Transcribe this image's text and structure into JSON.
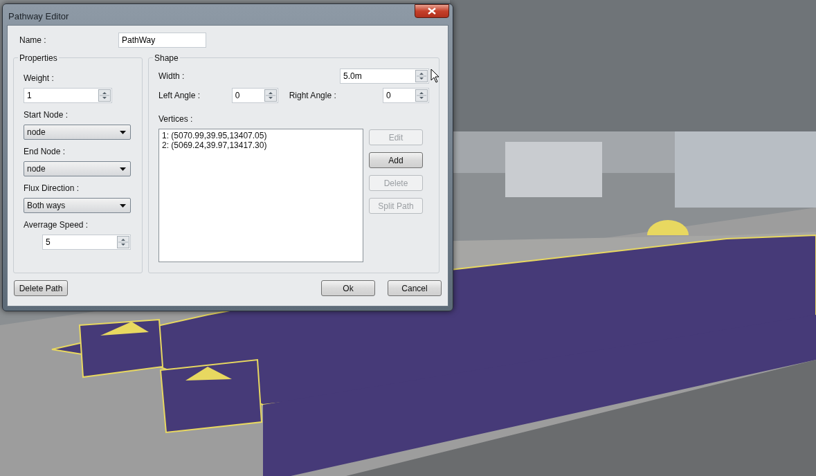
{
  "window": {
    "title": "Pathway Editor"
  },
  "name": {
    "label": "Name :",
    "value": "PathWay"
  },
  "properties": {
    "title": "Properties",
    "fields": [
      {
        "kind": "spin",
        "label": "Weight :",
        "value": "1"
      },
      {
        "kind": "select",
        "label": "Start Node :",
        "value": "node"
      },
      {
        "kind": "select",
        "label": "End Node :",
        "value": "node"
      },
      {
        "kind": "select",
        "label": "Flux Direction :",
        "value": "Both ways"
      },
      {
        "kind": "spin",
        "label": "Averrage Speed :",
        "value": "5"
      }
    ]
  },
  "shape": {
    "title": "Shape",
    "width": {
      "label": "Width :",
      "value": "5.0m"
    },
    "left_angle": {
      "label": "Left Angle :",
      "value": "0"
    },
    "right_angle": {
      "label": "Right Angle :",
      "value": "0"
    },
    "vertices": {
      "label": "Vertices :",
      "items": [
        "1: (5070.99,39.95,13407.05)",
        "2: (5069.24,39.97,13417.30)"
      ]
    },
    "buttons": [
      {
        "label": "Edit",
        "disabled": true
      },
      {
        "label": "Add",
        "disabled": false
      },
      {
        "label": "Delete",
        "disabled": true
      },
      {
        "label": "Split Path",
        "disabled": true
      }
    ]
  },
  "footer": {
    "delete_button": "Delete Path",
    "buttons": [
      "Ok",
      "Cancel"
    ]
  }
}
